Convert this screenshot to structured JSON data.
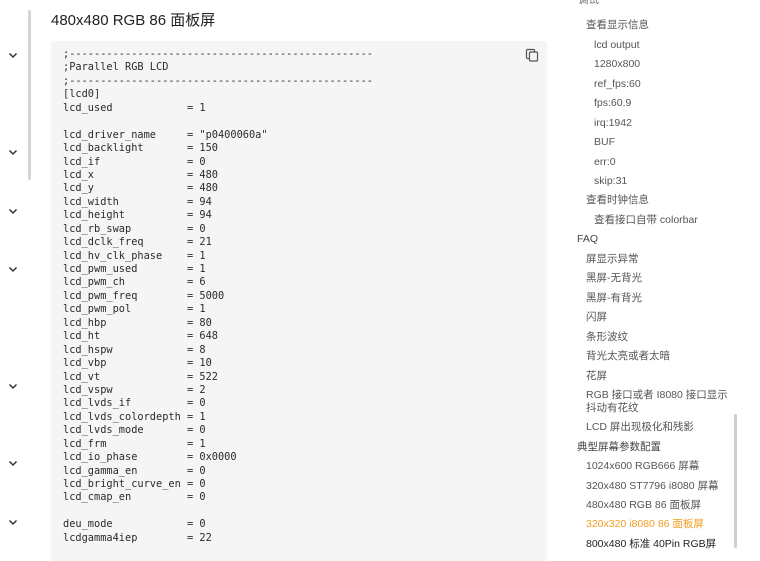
{
  "title": "480x480 RGB 86 面板屏",
  "code": [
    ";-------------------------------------------------",
    ";Parallel RGB LCD",
    ";-------------------------------------------------",
    "[lcd0]",
    "lcd_used            = 1",
    "",
    "lcd_driver_name     = \"p0400060a\"",
    "lcd_backlight       = 150",
    "lcd_if              = 0",
    "lcd_x               = 480",
    "lcd_y               = 480",
    "lcd_width           = 94",
    "lcd_height          = 94",
    "lcd_rb_swap         = 0",
    "lcd_dclk_freq       = 21",
    "lcd_hv_clk_phase    = 1",
    "lcd_pwm_used        = 1",
    "lcd_pwm_ch          = 6",
    "lcd_pwm_freq        = 5000",
    "lcd_pwm_pol         = 1",
    "lcd_hbp             = 80",
    "lcd_ht              = 648",
    "lcd_hspw            = 8",
    "lcd_vbp             = 10",
    "lcd_vt              = 522",
    "lcd_vspw            = 2",
    "lcd_lvds_if         = 0",
    "lcd_lvds_colordepth = 1",
    "lcd_lvds_mode       = 0",
    "lcd_frm             = 1",
    "lcd_io_phase        = 0x0000",
    "lcd_gamma_en        = 0",
    "lcd_bright_curve_en = 0",
    "lcd_cmap_en         = 0",
    "",
    "deu_mode            = 0",
    "lcdgamma4iep        = 22"
  ],
  "toc": {
    "clipped_top": "调试",
    "items": [
      {
        "label": "查看显示信息"
      },
      {
        "label": "lcd output"
      },
      {
        "label": "1280x800"
      },
      {
        "label": "ref_fps:60"
      },
      {
        "label": "fps:60.9"
      },
      {
        "label": "irq:1942"
      },
      {
        "label": "BUF"
      },
      {
        "label": "err:0"
      },
      {
        "label": "skip:31"
      },
      {
        "label": "查看时钟信息"
      },
      {
        "label": "查看接口自带 colorbar"
      },
      {
        "label": "FAQ"
      },
      {
        "label": "屏显示异常"
      },
      {
        "label": "黑屏-无背光"
      },
      {
        "label": "黑屏-有背光"
      },
      {
        "label": "闪屏"
      },
      {
        "label": "条形波纹"
      },
      {
        "label": "背光太亮或者太暗"
      },
      {
        "label": "花屏"
      },
      {
        "label": "RGB 接口或者 I8080 接口显示抖动有花纹"
      },
      {
        "label": "LCD 屏出现极化和残影"
      },
      {
        "label": "典型屏幕参数配置"
      },
      {
        "label": "1024x600 RGB666 屏幕"
      },
      {
        "label": "320x480 ST7796 i8080 屏幕"
      },
      {
        "label": "480x480 RGB 86 面板屏"
      },
      {
        "label": "320x320 i8080 86 面板屏"
      },
      {
        "label": "800x480 标准 40Pin RGB屏"
      }
    ]
  },
  "colors": {
    "active": "#f29c1f",
    "code_bg": "#f5f5f5"
  }
}
